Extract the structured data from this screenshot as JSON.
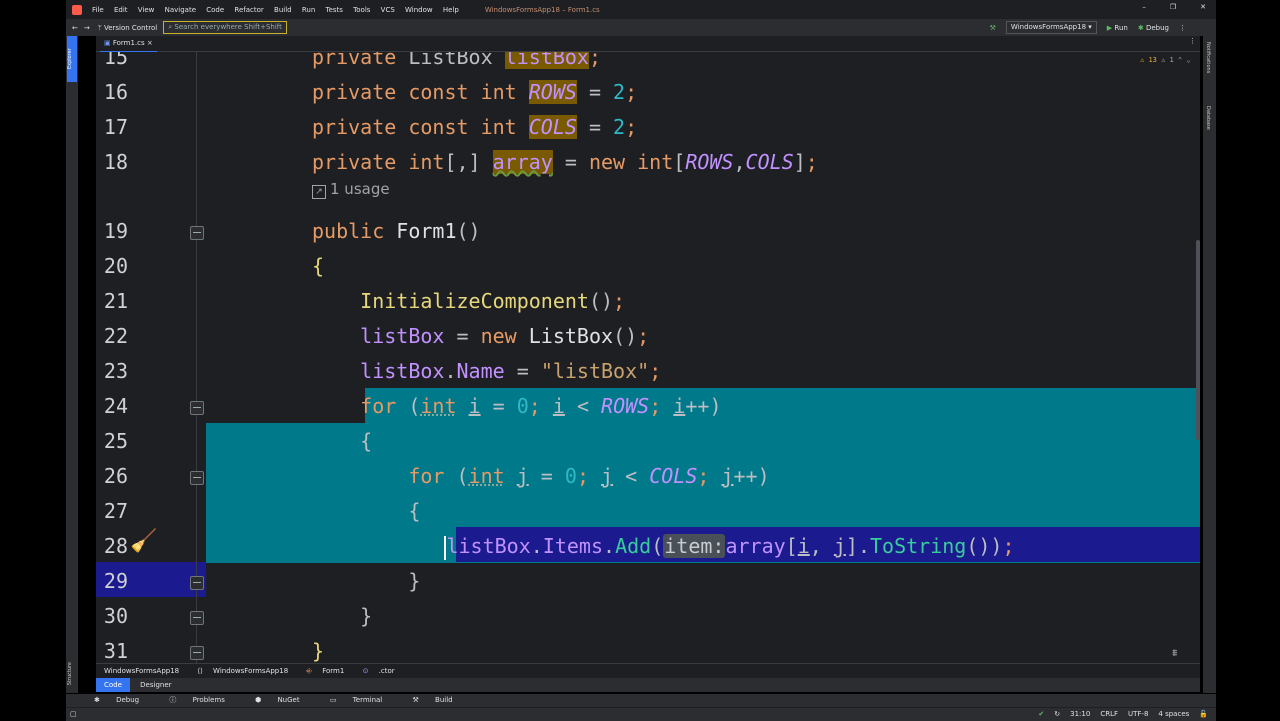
{
  "titlebar": {
    "menu": [
      "File",
      "Edit",
      "View",
      "Navigate",
      "Code",
      "Refactor",
      "Build",
      "Run",
      "Tests",
      "Tools",
      "VCS",
      "Window",
      "Help"
    ],
    "window_title": "WindowsFormsApp18 – Form1.cs"
  },
  "toolbar": {
    "vcs": "Version Control",
    "search_placeholder": "Search everywhere   Shift+Shift",
    "run_config": "WindowsFormsApp18",
    "run_label": "Run",
    "debug_label": "Debug"
  },
  "left_strip": {
    "explorer": "Explorer",
    "structure": "Structure"
  },
  "right_strip": {
    "notifications": "Notifications",
    "database": "Database"
  },
  "tab": {
    "label": "Form1.cs"
  },
  "inspection": {
    "warnings": "13",
    "weak": "1"
  },
  "usage_hint": "1 usage",
  "line_numbers": [
    "15",
    "16",
    "17",
    "18",
    "19",
    "20",
    "21",
    "22",
    "23",
    "24",
    "25",
    "26",
    "27",
    "28",
    "29",
    "30",
    "31"
  ],
  "breadcrumb": [
    "WindowsFormsApp18",
    "WindowsFormsApp18",
    "Form1",
    ".ctor"
  ],
  "editor_tabs": [
    "Code",
    "Designer"
  ],
  "bottom_tools": [
    "Debug",
    "Problems",
    "NuGet",
    "Terminal",
    "Build"
  ],
  "status": {
    "position": "31:10",
    "line_sep": "CRLF",
    "encoding": "UTF-8",
    "indent": "4 spaces"
  }
}
